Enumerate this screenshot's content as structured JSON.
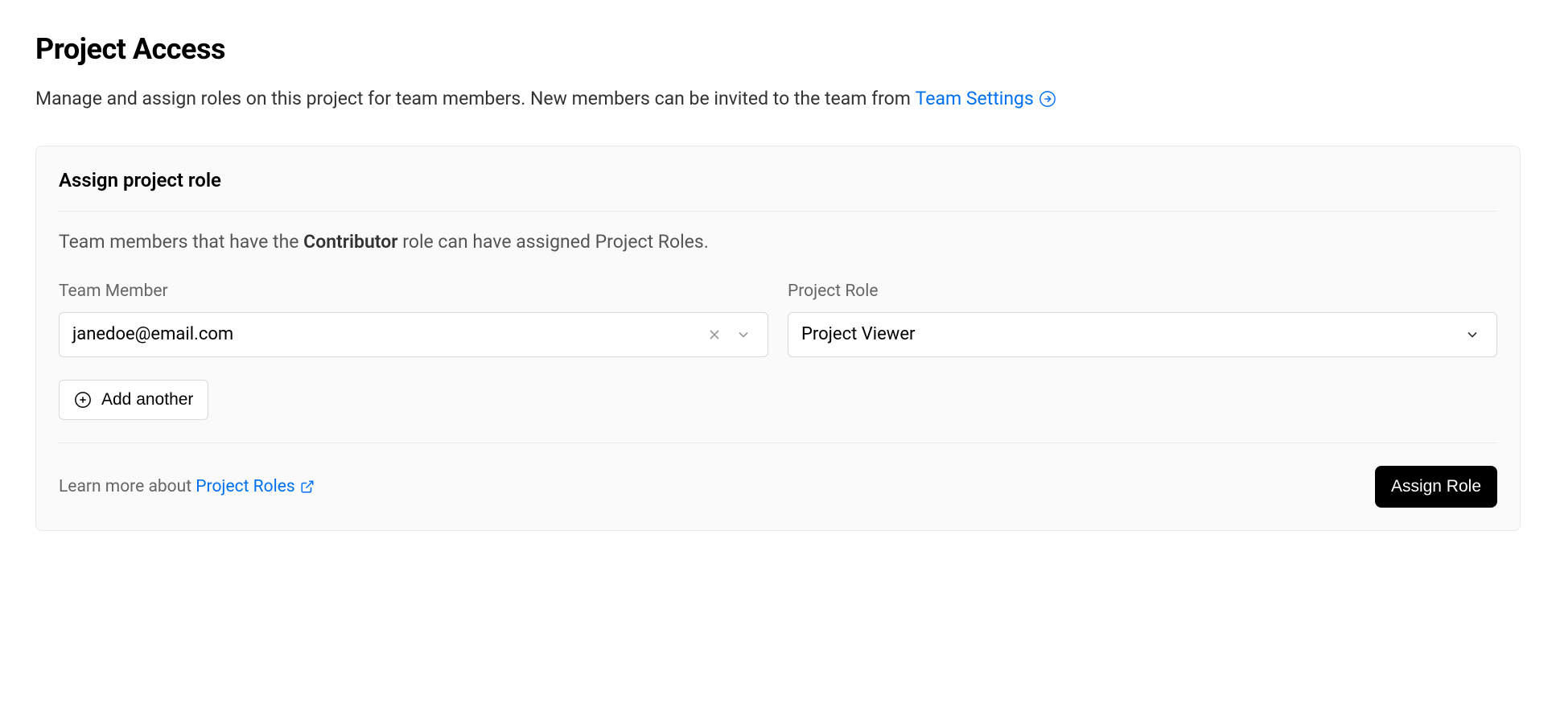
{
  "page": {
    "title": "Project Access",
    "description_prefix": "Manage and assign roles on this project for team members. New members can be invited to the team from ",
    "team_settings_link": "Team Settings"
  },
  "card": {
    "title": "Assign project role",
    "subtitle_prefix": "Team members that have the ",
    "subtitle_strong": "Contributor",
    "subtitle_suffix": " role can have assigned Project Roles.",
    "team_member_label": "Team Member",
    "team_member_value": "janedoe@email.com",
    "project_role_label": "Project Role",
    "project_role_value": "Project Viewer",
    "add_another_label": "Add another",
    "footer_text_prefix": "Learn more about ",
    "footer_link": "Project Roles",
    "assign_button": "Assign Role"
  }
}
